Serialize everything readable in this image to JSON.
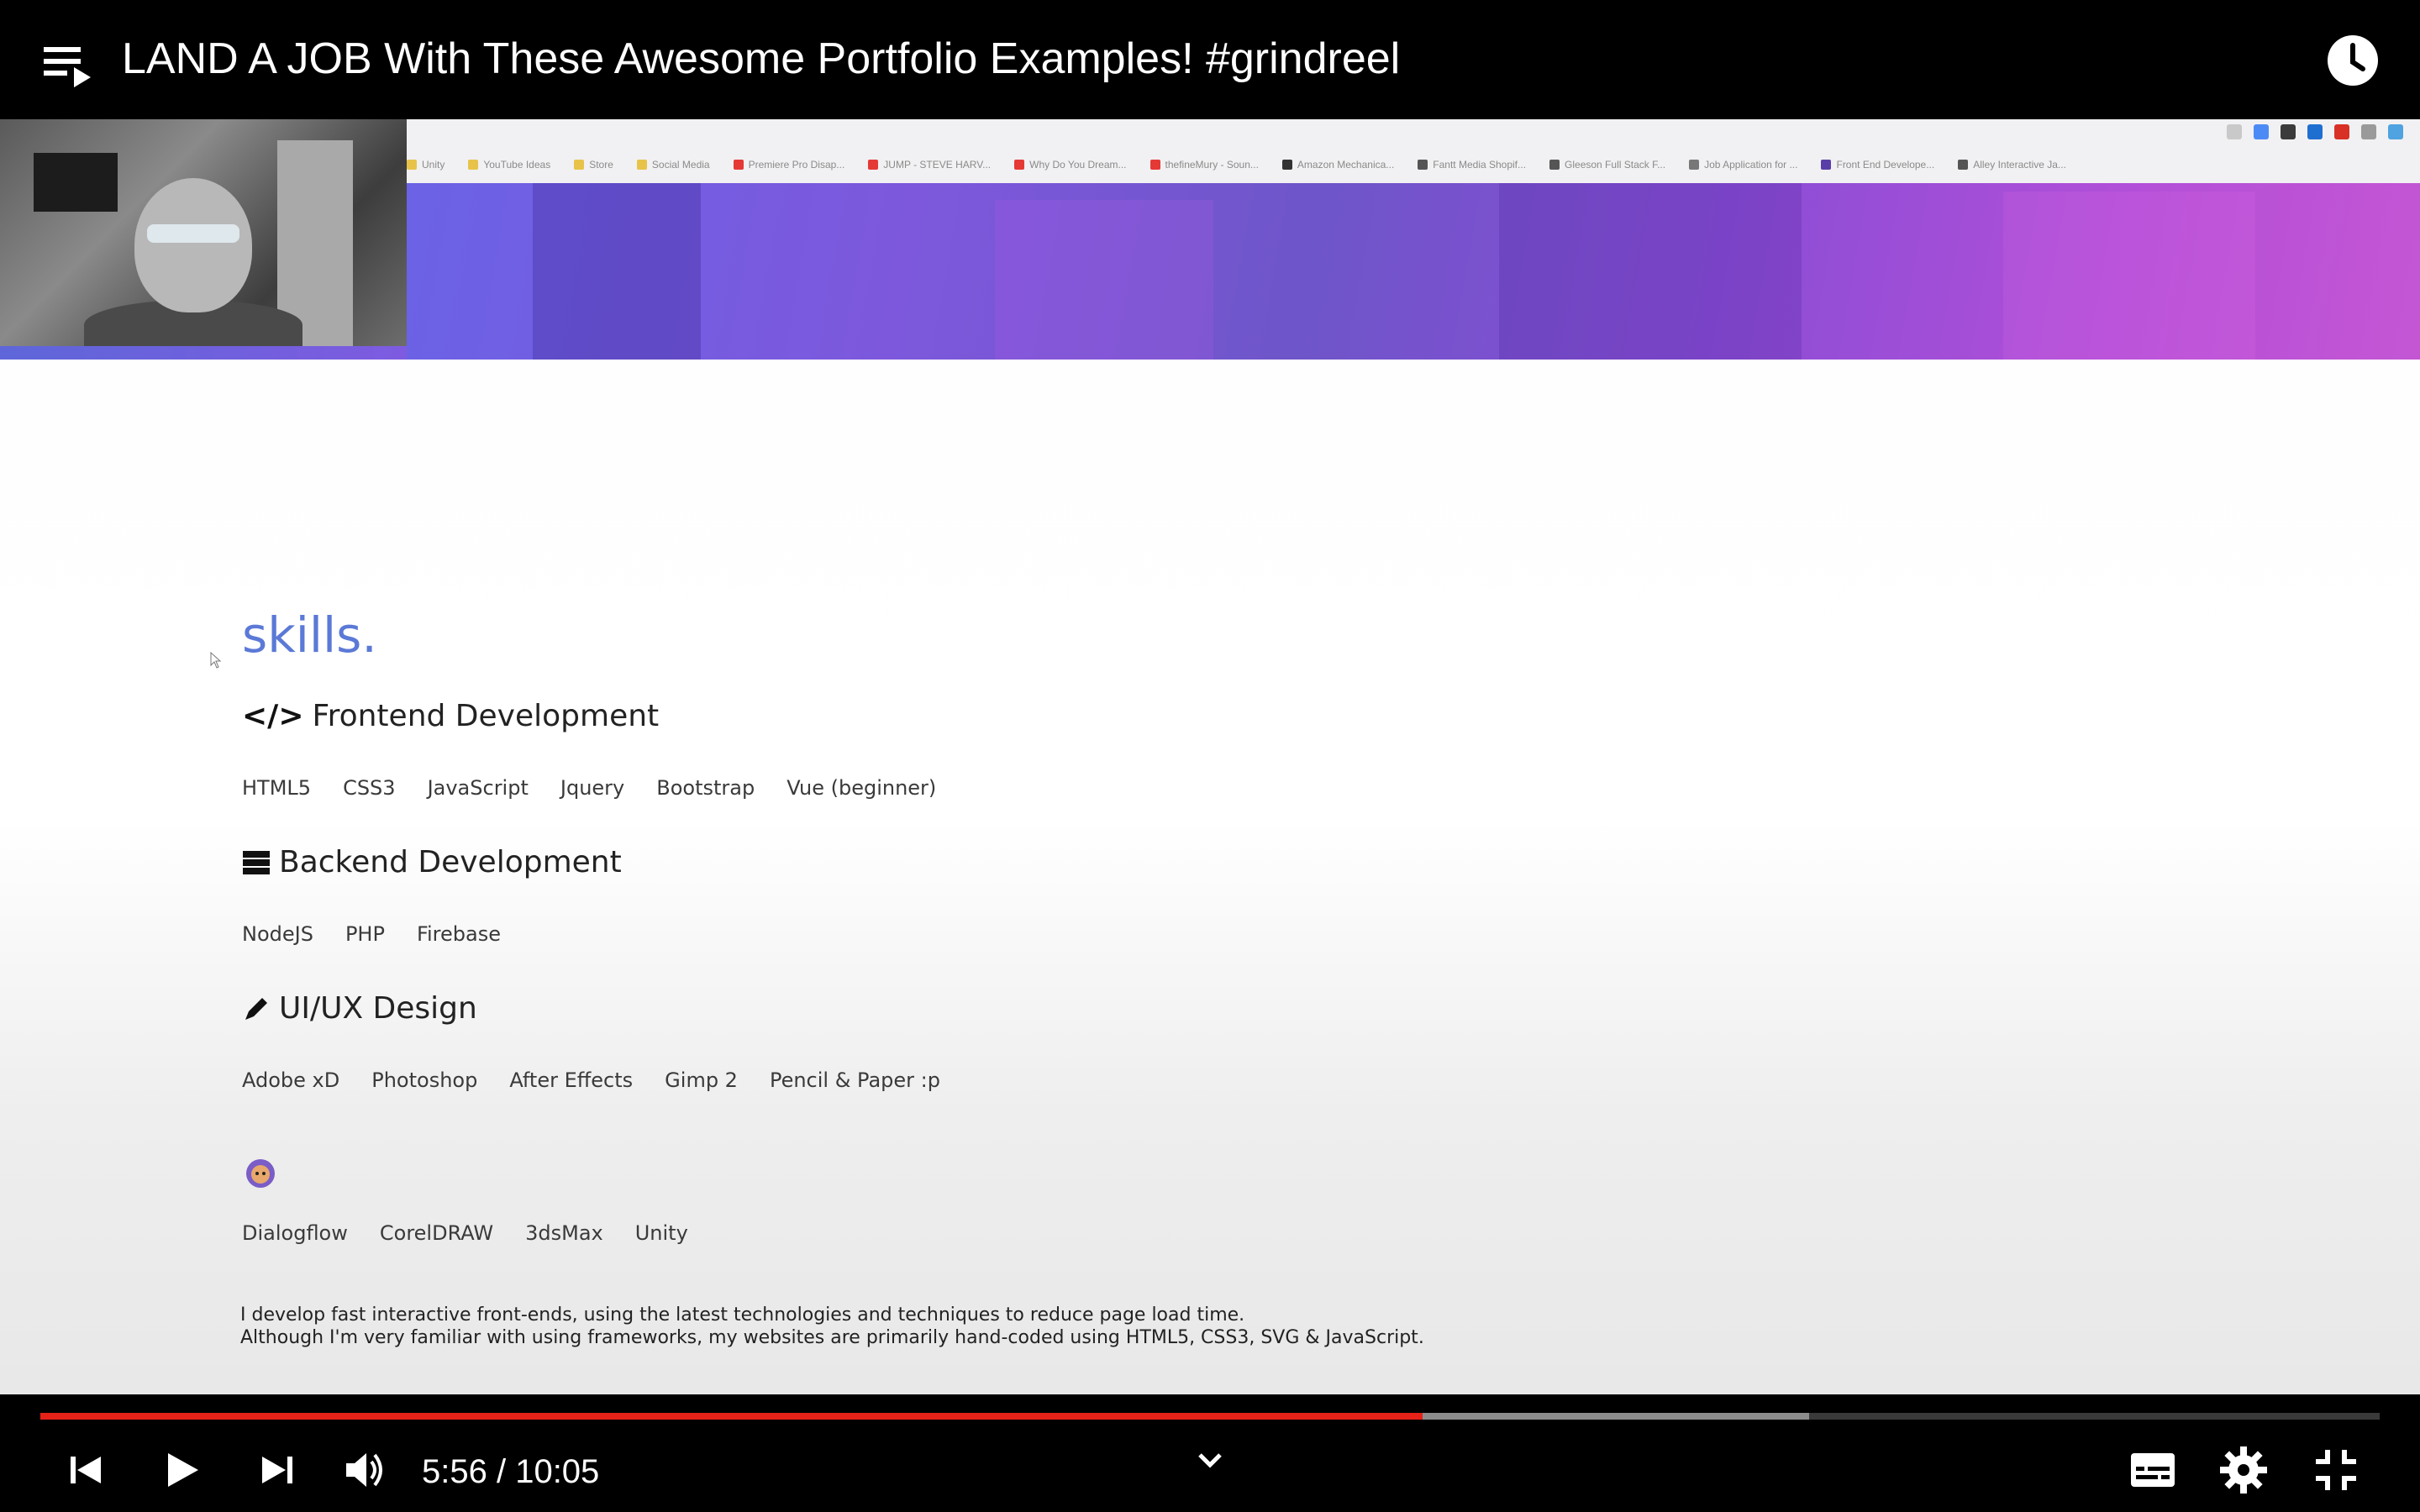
{
  "player": {
    "title": "LAND A JOB With These Awesome Portfolio Examples! #grindreel",
    "current_time": "5:56",
    "separator": " / ",
    "duration": "10:05",
    "progress_played": 0.591,
    "progress_buffered": 0.756,
    "icons": {
      "playlist": "playlist-icon",
      "watch_later": "clock-icon",
      "prev": "skip-previous-icon",
      "play": "play-icon",
      "next": "skip-next-icon",
      "volume": "volume-icon",
      "chevron": "chevron-down-icon",
      "subtitles": "subtitles-icon",
      "settings": "gear-icon",
      "exit_fullscreen": "exit-fullscreen-icon"
    },
    "colors": {
      "progress": "#e62117",
      "accent": "#5b79d6",
      "banner_start": "#6b62e6",
      "banner_end": "#c456d4"
    }
  },
  "browser": {
    "bookmarks": [
      "Unity",
      "YouTube Ideas",
      "Store",
      "Social Media",
      "Premiere Pro Disap...",
      "JUMP - STEVE HARV...",
      "Why Do You Dream...",
      "thefineMury - Soun...",
      "Amazon Mechanica...",
      "Fantt Media Shopif...",
      "Gleeson Full Stack F...",
      "Job Application for ...",
      "Front End Develope...",
      "Alley Interactive Ja..."
    ]
  },
  "skills": {
    "heading": "skills.",
    "categories": [
      {
        "icon": "code-icon",
        "title": "Frontend Development",
        "items": [
          "HTML5",
          "CSS3",
          "JavaScript",
          "Jquery",
          "Bootstrap",
          "Vue (beginner)"
        ]
      },
      {
        "icon": "server-icon",
        "title": "Backend Development",
        "items": [
          "NodeJS",
          "PHP",
          "Firebase"
        ]
      },
      {
        "icon": "pencil-icon",
        "title": "UI/UX Design",
        "items": [
          "Adobe xD",
          "Photoshop",
          "After Effects",
          "Gimp 2",
          "Pencil & Paper :p"
        ]
      },
      {
        "icon": "emoji-icon",
        "title": "",
        "items": [
          "Dialogflow",
          "CorelDRAW",
          "3dsMax",
          "Unity"
        ]
      }
    ],
    "description": [
      "I develop fast interactive front-ends, using the latest technologies and techniques to reduce page load time.",
      "Although I'm very familiar with using frameworks, my websites are primarily hand-coded using HTML5, CSS3, SVG & JavaScript."
    ]
  }
}
